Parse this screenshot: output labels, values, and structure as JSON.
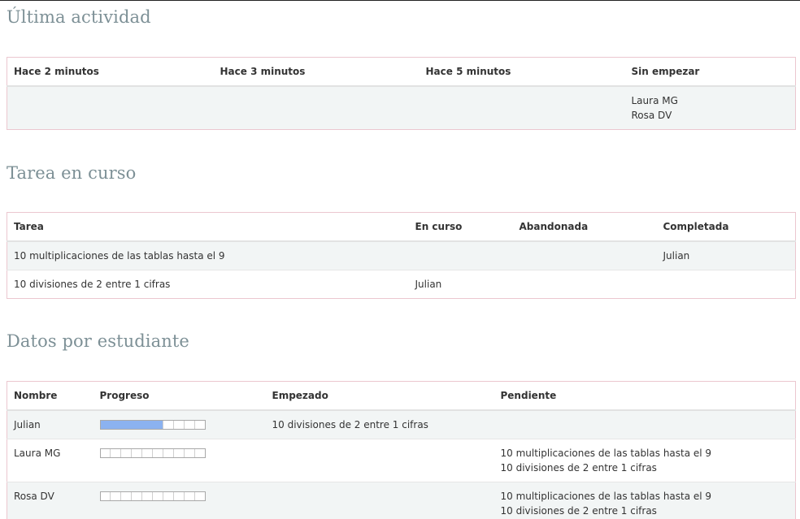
{
  "actividad": {
    "title": "Última actividad",
    "headers": [
      "Hace 2 minutos",
      "Hace 3 minutos",
      "Hace 5 minutos",
      "Sin empezar"
    ],
    "sin_empezar": [
      "Laura MG",
      "Rosa DV"
    ]
  },
  "tarea": {
    "title": "Tarea en curso",
    "headers": [
      "Tarea",
      "En curso",
      "Abandonada",
      "Completada"
    ],
    "rows": [
      {
        "tarea": "10 multiplicaciones de las tablas hasta el 9",
        "en_curso": "",
        "abandonada": "",
        "completada": "Julian"
      },
      {
        "tarea": "10 divisiones de 2 entre 1 cifras",
        "en_curso": "Julian",
        "abandonada": "",
        "completada": ""
      }
    ]
  },
  "datos": {
    "title": "Datos por estudiante",
    "headers": [
      "Nombre",
      "Progreso",
      "Empezado",
      "Pendiente"
    ],
    "rows": [
      {
        "nombre": "Julian",
        "progreso": 0.6,
        "empezado": [
          "10 divisiones de 2 entre 1 cifras"
        ],
        "pendiente": []
      },
      {
        "nombre": "Laura MG",
        "progreso": 0,
        "empezado": [],
        "pendiente": [
          "10 multiplicaciones de las tablas hasta el 9",
          "10 divisiones de 2 entre 1 cifras"
        ]
      },
      {
        "nombre": "Rosa DV",
        "progreso": 0,
        "empezado": [],
        "pendiente": [
          "10 multiplicaciones de las tablas hasta el 9",
          "10 divisiones de 2 entre 1 cifras"
        ]
      }
    ]
  },
  "colors": {
    "heading": "#7d9096",
    "table_border": "#ebc7cf",
    "row_shade": "#f2f5f5",
    "progress_fill": "#8bb2f0"
  }
}
